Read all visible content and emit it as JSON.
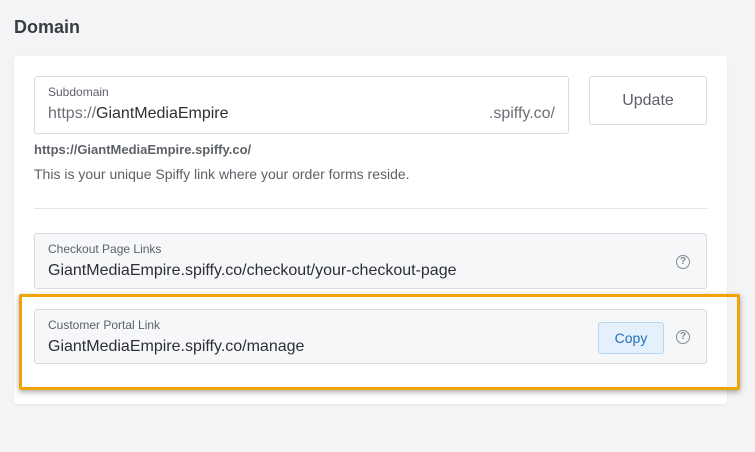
{
  "section": {
    "title": "Domain"
  },
  "subdomain": {
    "label": "Subdomain",
    "prefix": "https://",
    "value": "GiantMediaEmpire",
    "suffix": ".spiffy.co/"
  },
  "update_label": "Update",
  "link_preview": "https://GiantMediaEmpire.spiffy.co/",
  "link_help": "This is your unique Spiffy link where your order forms reside.",
  "checkout": {
    "label": "Checkout Page Links",
    "value": "GiantMediaEmpire.spiffy.co/checkout/your-checkout-page"
  },
  "portal": {
    "label": "Customer Portal Link",
    "value": "GiantMediaEmpire.spiffy.co/manage",
    "copy_label": "Copy"
  },
  "icons": {
    "help": "question-circle-icon"
  },
  "colors": {
    "highlight": "#f0a30a",
    "copy_text": "#1f6fbd"
  }
}
